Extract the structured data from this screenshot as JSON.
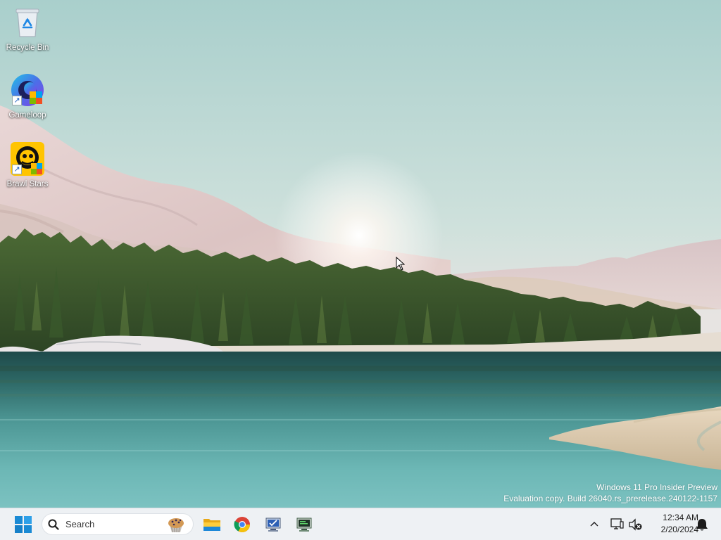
{
  "desktop": {
    "icons": [
      {
        "label": "Recycle Bin",
        "icon": "recycle-bin-icon",
        "shortcut": false
      },
      {
        "label": "Gameloop",
        "icon": "gameloop-icon",
        "shortcut": true
      },
      {
        "label": "Brawl Stars",
        "icon": "brawl-stars-icon",
        "shortcut": true
      }
    ],
    "shortcut_glyph": "↗"
  },
  "watermark": {
    "line1": "Windows 11 Pro Insider Preview",
    "line2": "Evaluation copy. Build 26040.rs_prerelease.240122-1157"
  },
  "taskbar": {
    "start_icon": "windows-start-icon",
    "search": {
      "placeholder": "Search",
      "icon": "search-icon",
      "highlight_icon": "muffin-icon"
    },
    "pinned": [
      {
        "name": "File Explorer",
        "icon": "folder-icon"
      },
      {
        "name": "Google Chrome",
        "icon": "chrome-icon"
      },
      {
        "name": "App",
        "icon": "monitor-check-icon"
      },
      {
        "name": "App",
        "icon": "terminal-monitor-icon"
      }
    ],
    "tray": {
      "chevron_glyph": "^",
      "network_icon": "network-disconnected-icon",
      "volume_icon": "volume-muted-icon",
      "time": "12:34 AM",
      "date": "2/20/2024",
      "notification_icon": "bell-icon"
    }
  },
  "colors": {
    "accent": "#0067c0",
    "taskbar_bg": "#eef1f4",
    "windows_blue": "#1a8ad4"
  }
}
